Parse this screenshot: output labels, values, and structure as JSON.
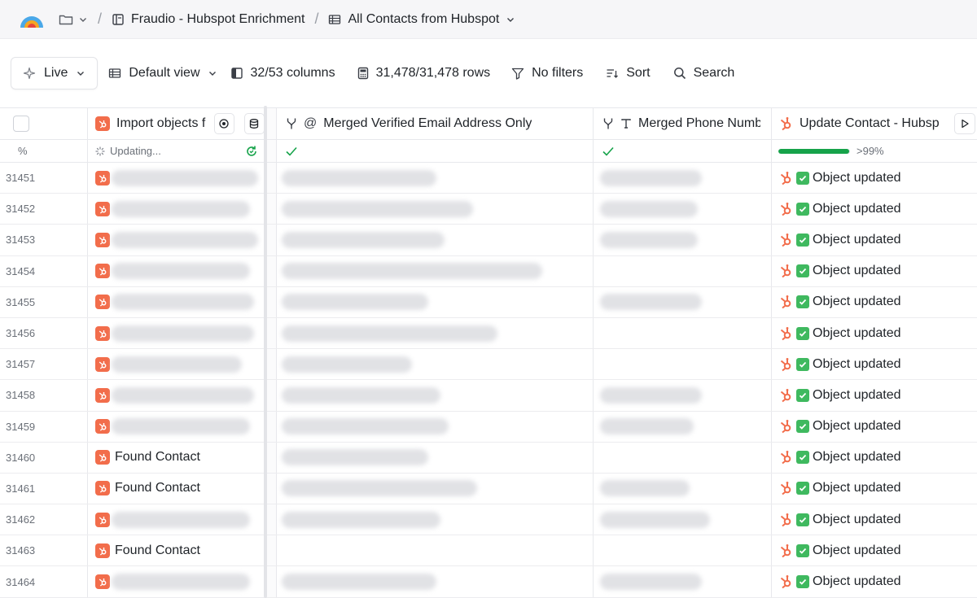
{
  "breadcrumb": {
    "workspace": "Fraudio - Hubspot Enrichment",
    "table": "All Contacts from Hubspot"
  },
  "toolbar": {
    "live_label": "Live",
    "view_label": "Default view",
    "columns_label": "32/53 columns",
    "rows_label": "31,478/31,478 rows",
    "filters_label": "No filters",
    "sort_label": "Sort",
    "search_label": "Search"
  },
  "columns": {
    "row_header": "%",
    "col1": "Import objects f",
    "col2": "Merged Verified Email Address Only",
    "col3": "Merged Phone Numb",
    "col4": "Update Contact - Hubsp"
  },
  "status_row": {
    "col1_status": "Updating...",
    "col4_progress_label": ">99%",
    "col4_progress_value": 0.99
  },
  "rows": [
    {
      "id": "31451",
      "col1_text": "",
      "col4": "Object updated"
    },
    {
      "id": "31452",
      "col1_text": "",
      "col4": "Object updated"
    },
    {
      "id": "31453",
      "col1_text": "",
      "col4": "Object updated"
    },
    {
      "id": "31454",
      "col1_text": "",
      "col4": "Object updated"
    },
    {
      "id": "31455",
      "col1_text": "",
      "col4": "Object updated"
    },
    {
      "id": "31456",
      "col1_text": "",
      "col4": "Object updated"
    },
    {
      "id": "31457",
      "col1_text": "",
      "col4": "Object updated"
    },
    {
      "id": "31458",
      "col1_text": "",
      "col4": "Object updated"
    },
    {
      "id": "31459",
      "col1_text": "",
      "col4": "Object updated"
    },
    {
      "id": "31460",
      "col1_text": "Found Contact",
      "col4": "Object updated"
    },
    {
      "id": "31461",
      "col1_text": "Found Contact",
      "col4": "Object updated"
    },
    {
      "id": "31462",
      "col1_text": "",
      "col4": "Object updated"
    },
    {
      "id": "31463",
      "col1_text": "Found Contact",
      "col4": "Object updated"
    },
    {
      "id": "31464",
      "col1_text": "",
      "col4": "Object updated"
    }
  ],
  "colors": {
    "hubspot": "#f26d4b",
    "success": "#16a34a",
    "check": "#3fb95f"
  }
}
